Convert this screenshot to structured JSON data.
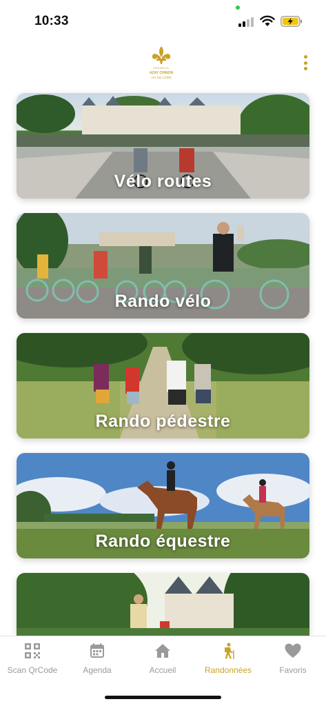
{
  "status_bar": {
    "time": "10:33",
    "signal_icon": "cellular-signal-icon",
    "wifi_icon": "wifi-icon",
    "battery_icon": "battery-charging-icon"
  },
  "header": {
    "logo_icon": "fleur-de-lis-logo",
    "logo_lines": [
      "AZAY CHINON",
      "VAL DE LOIRE"
    ],
    "menu_icon": "more-vertical-icon"
  },
  "colors": {
    "accent": "#c9a227",
    "tab_inactive": "#9a9a9a"
  },
  "cards": [
    {
      "label": "Vélo routes"
    },
    {
      "label": "Rando vélo"
    },
    {
      "label": "Rando pédestre"
    },
    {
      "label": "Rando équestre"
    },
    {
      "label": ""
    }
  ],
  "tabs": [
    {
      "label": "Scan QrCode",
      "icon": "qrcode-icon",
      "active": false
    },
    {
      "label": "Agenda",
      "icon": "calendar-icon",
      "active": false
    },
    {
      "label": "Accueil",
      "icon": "home-icon",
      "active": false
    },
    {
      "label": "Randonnées",
      "icon": "hiker-icon",
      "active": true
    },
    {
      "label": "Favoris",
      "icon": "heart-icon",
      "active": false
    }
  ]
}
